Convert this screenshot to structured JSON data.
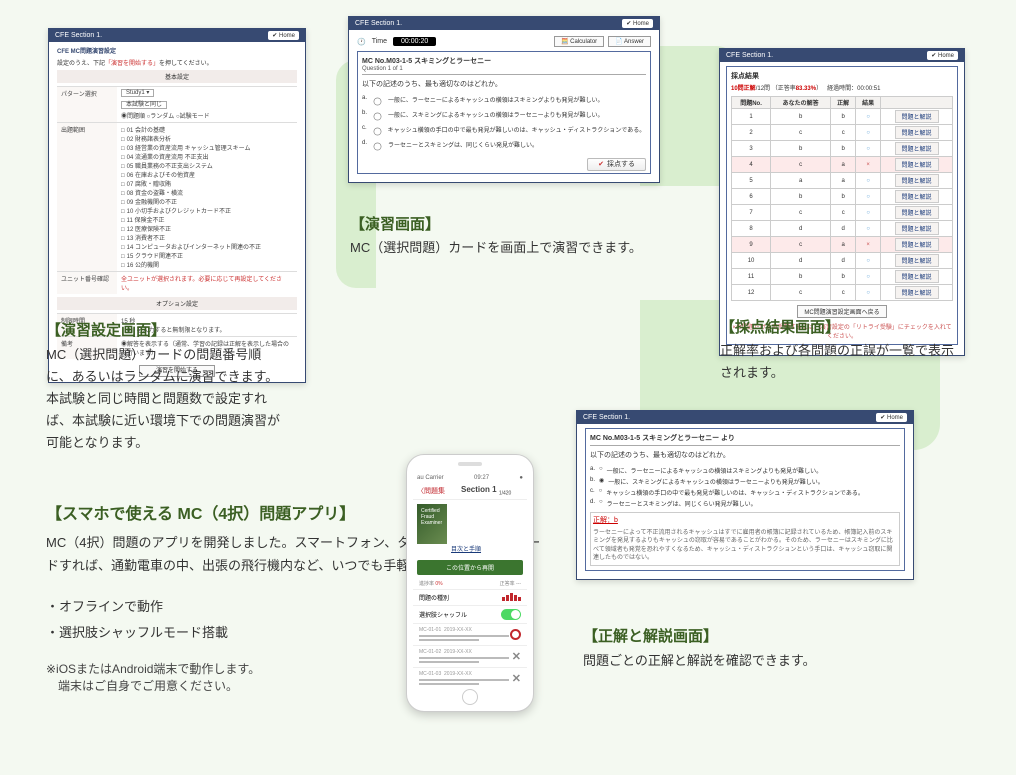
{
  "arrows": true,
  "common": {
    "header_app": "CFE Section 1.",
    "home_btn": "✔ Home"
  },
  "settings": {
    "title": "CFE MC問題演習設定",
    "note_prefix": "設定のうえ、下記",
    "note_red": "「演習を開始する」",
    "note_suffix": "を押してください。",
    "sect_basic": "基本設定",
    "row_pattern_label": "パターン選択",
    "pattern_opts": [
      "Study1 ▾",
      "本試験と同じ"
    ],
    "pattern_radio": "◉問題順  ○ランダム  ○試験モード",
    "row_range_label": "出題範囲",
    "range_items": [
      "01 会計の基礎",
      "02 財務諸表分析",
      "03 経営業の資産流用 キャッシュ管理スキーム",
      "04 流通業の資産流用 不正支出",
      "05 職員業務の不正支出システム",
      "06 在庫およびその他資産",
      "07 腐敗・贈収賄",
      "08 資金の盗難・横流",
      "09 金融機関の不正",
      "10 小切手およびクレジットカード不正",
      "11 保険金不正",
      "12 医療保険不正",
      "13 消費者不正",
      "14 コンピュータおよびインターネット関連の不正",
      "15 クラウド関連不正",
      "16 公的機関"
    ],
    "row_unit_label": "ユニット番号確認",
    "unit_val": "全ユニットが選択されます。必要に応じて再設定してください。",
    "sect_option": "オプション設定",
    "row_time_label": "制限時間",
    "time_val": "15 秒",
    "time_line2": "「0」を入力すると無制限となります。",
    "row_note_label": "備考",
    "note_val": "◉解答を表示する（通常、学習の記録は正解を表示した場合のみ行います）",
    "start_btn": "演習を開始する"
  },
  "practice": {
    "time_label": "Time",
    "timer": "00:00:20",
    "calc_btn": "🧮 Calculator",
    "ans_btn": "📄 Answer",
    "mc_no": "MC No.M03-1-5   スキミングとラーセニー",
    "q_of": "Question 1 of 1",
    "q_text": "以下の記述のうち、最も適切なのはどれか。",
    "choices": [
      "一般に、ラーセニーによるキャッシュの横領はスキミングよりも発見が難しい。",
      "一般に、スキミングによるキャッシュの横領はラーセニーよりも発見が難しい。",
      "キャッシュ横領の手口の中で最も発見が難しいのは、キャッシュ・ディストラクションである。",
      "ラーセニーとスキミングは、同じくらい発見が難しい。"
    ],
    "choice_labels": [
      "a.",
      "b.",
      "c.",
      "d."
    ],
    "submit": "採点する"
  },
  "results": {
    "box_title": "採点結果",
    "summary_correct": "10問正解",
    "summary_total": "/12問",
    "summary_rate_label": "（正答率",
    "summary_rate": "83.33%",
    "summary_rate_close": "）",
    "elapsed_label": "経過時間：",
    "elapsed": "00:00:51",
    "th": [
      "問題No.",
      "あなたの解答",
      "正解",
      "結果",
      ""
    ],
    "rows": [
      {
        "no": "1",
        "you": "b",
        "ans": "b",
        "ok": true
      },
      {
        "no": "2",
        "you": "c",
        "ans": "c",
        "ok": true
      },
      {
        "no": "3",
        "you": "b",
        "ans": "b",
        "ok": true
      },
      {
        "no": "4",
        "you": "c",
        "ans": "a",
        "ok": false
      },
      {
        "no": "5",
        "you": "a",
        "ans": "a",
        "ok": true
      },
      {
        "no": "6",
        "you": "b",
        "ans": "b",
        "ok": true
      },
      {
        "no": "7",
        "you": "c",
        "ans": "c",
        "ok": true
      },
      {
        "no": "8",
        "you": "d",
        "ans": "d",
        "ok": true
      },
      {
        "no": "9",
        "you": "c",
        "ans": "a",
        "ok": false
      },
      {
        "no": "10",
        "you": "d",
        "ans": "d",
        "ok": true
      },
      {
        "no": "11",
        "you": "b",
        "ans": "b",
        "ok": true
      },
      {
        "no": "12",
        "you": "c",
        "ans": "c",
        "ok": true
      }
    ],
    "view_btn": "問題と解説",
    "return_btn": "MC問題演習設定画面へ戻る",
    "note": "×の問題だけを再受験するには、演習設定の「リトライ受験」にチェックを入れてください。"
  },
  "explain": {
    "mc_no": "MC No.M03-1-5   スキミングとラーセニー より",
    "q_text": "以下の記述のうち、最も適切なのはどれか。",
    "choices": [
      "一般に、ラーセニーによるキャッシュの横領はスキミングよりも発見が難しい。",
      "一般に、スキミングによるキャッシュの横領はラーセニーよりも発見が難しい。",
      "キャッシュ横領の手口の中で最も発見が難しいのは、キャッシュ・ディストラクションである。",
      "ラーセニーとスキミングは、同じくらい発見が難しい。"
    ],
    "choice_labels": [
      "a.",
      "b.",
      "c.",
      "d."
    ],
    "selected_index": 1,
    "correct_label": "正解：b",
    "body": "ラーセニーによって不正流用されるキャッシュはすでに雇用者の帳簿に記録されているため、帳簿記入前のスキミングを発見するよりもキャッシュの窃取が容易であることがわかる。そのため、ラーセニーはスキミングに比べて領域者も発覚を恐れやすくなるため、キャッシュ・ディストラクションという手口は、キャッシュ窃取に関連したものではない。"
  },
  "captions": {
    "settings": "【演習設定画面】",
    "practice": "【演習画面】",
    "results": "【採点結果画面】",
    "explain": "【正解と解説画面】"
  },
  "descs": {
    "settings": "MC（選択問題）カードの問題番号順に、あるいはランダムに演習できます。本試験と同じ時間と問題数で設定すれば、本試験に近い環境下での問題演習が可能となります。",
    "practice": "MC（選択問題）カードを画面上で演習できます。",
    "results": "正解率および各問題の正誤が一覧で表示されます。",
    "explain": "問題ごとの正解と解説を確認できます。"
  },
  "app": {
    "title": "【スマホで使える MC（4択）問題アプリ】",
    "desc": "MC（4択）問題のアプリを開発しました。スマートフォン、タブレットにダウンロードすれば、通勤電車の中、出張の飛行機内など、いつでも手軽に演習できます。",
    "bullets": [
      "・オフラインで動作",
      "・選択肢シャッフルモード搭載"
    ],
    "note1": "※iOSまたはAndroid端末で動作します。",
    "note2": "　端末はご自身でご用意ください。"
  },
  "phone": {
    "carrier": "au Carrier",
    "time": "09:27",
    "batt": "●",
    "back": "〈問題集",
    "title": "Section 1",
    "title_sub": "1/420",
    "cover_lines": [
      "Certified",
      "Fraud",
      "Examiner"
    ],
    "toc_link": "目次と手順",
    "green_btn": "この位置から再開",
    "stat_l_label": "進捗率",
    "stat_l_val": "0%",
    "stat_r_label": "正答率",
    "stat_r_val": "---",
    "row_problems": "問題の種別",
    "bars": [
      4,
      6,
      8,
      6,
      4
    ],
    "row_shuffle": "選択肢シャッフル",
    "items": [
      {
        "num": "MC-01-01",
        "date": "2019-XX-XX",
        "status": "o"
      },
      {
        "num": "MC-01-02",
        "date": "2019-XX-XX",
        "status": "x"
      },
      {
        "num": "MC-01-03",
        "date": "2019-XX-XX",
        "status": "x"
      }
    ]
  }
}
